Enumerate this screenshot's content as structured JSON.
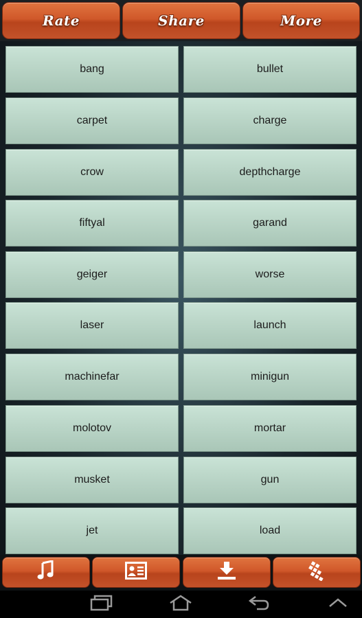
{
  "header": {
    "rate_label": "Rate",
    "share_label": "Share",
    "more_label": "More"
  },
  "sounds": [
    "bang",
    "bullet",
    "carpet",
    "charge",
    "crow",
    "depthcharge",
    "fiftyal",
    "garand",
    "geiger",
    "worse",
    "laser",
    "launch",
    "machinefar",
    "minigun",
    "molotov",
    "mortar",
    "musket",
    "gun",
    "jet",
    "load"
  ],
  "toolbar": {
    "icons": [
      "music-note-icon",
      "contact-card-icon",
      "download-icon",
      "apps-icon"
    ]
  },
  "navigation": {
    "icons": [
      "recent-apps-icon",
      "home-icon",
      "back-icon",
      "menu-up-icon"
    ]
  },
  "colors": {
    "accent": "#d0582a",
    "cell": "#bcd7c9",
    "background": "#1a262c"
  }
}
